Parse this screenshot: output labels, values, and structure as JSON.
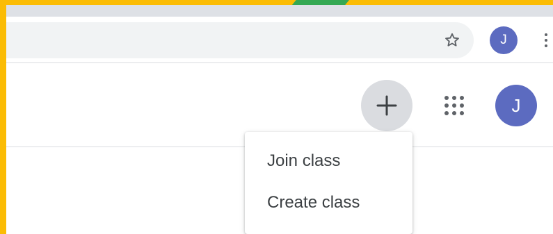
{
  "browser": {
    "star_icon": "star-outline-icon",
    "profile_initial": "J",
    "menu_icon": "kebab-vertical-icon",
    "colors": {
      "avatar": "#5C6BC0",
      "frame_accent": "#FBBC04",
      "tab_accent": "#34A853"
    }
  },
  "header": {
    "add_icon": "plus-icon",
    "apps_icon": "google-apps-grid-icon",
    "avatar_initial": "J"
  },
  "class_menu": {
    "items": [
      {
        "label": "Join class"
      },
      {
        "label": "Create class"
      }
    ]
  }
}
